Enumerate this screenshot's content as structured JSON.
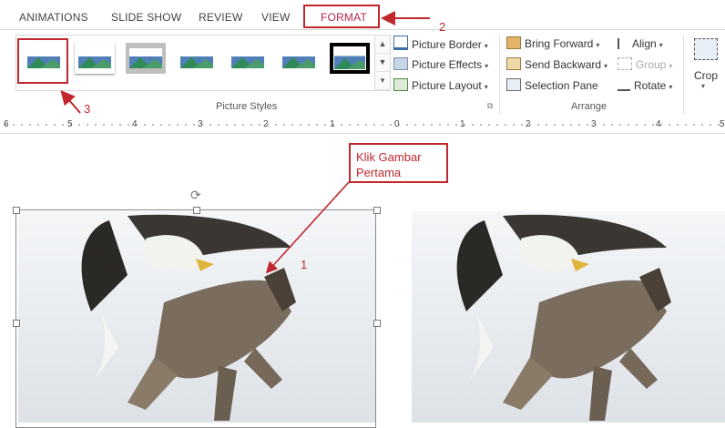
{
  "tabs": {
    "animations": "ANIMATIONS",
    "slideshow": "SLIDE SHOW",
    "review": "REVIEW",
    "view": "VIEW",
    "format": "FORMAT"
  },
  "ribbon": {
    "picture_styles_label": "Picture Styles",
    "arrange_label": "Arrange",
    "picture_border": "Picture Border",
    "picture_effects": "Picture Effects",
    "picture_layout": "Picture Layout",
    "bring_forward": "Bring Forward",
    "send_backward": "Send Backward",
    "selection_pane": "Selection Pane",
    "align": "Align",
    "group": "Group",
    "rotate": "Rotate",
    "crop": "Crop"
  },
  "ruler": {
    "labels": [
      "6",
      "5",
      "4",
      "3",
      "2",
      "1",
      "0",
      "1",
      "2",
      "3",
      "4",
      "5"
    ]
  },
  "annotations": {
    "callout_text": "Klik Gambar Pertama",
    "step1": "1",
    "step2": "2",
    "step3": "3"
  },
  "colors": {
    "annotation_red": "#c1272d",
    "format_tab": "#b4234a"
  }
}
